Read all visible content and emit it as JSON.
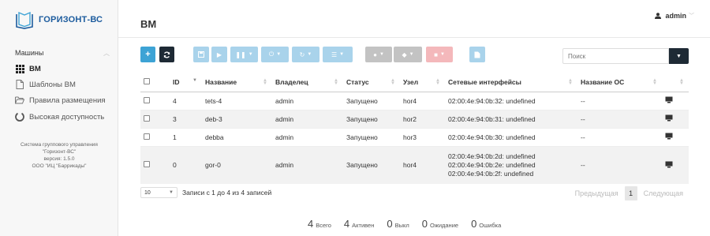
{
  "logo": {
    "text": "ГОРИЗОНТ-ВС"
  },
  "sidebar": {
    "section": "Машины",
    "items": [
      {
        "label": "ВМ",
        "icon": "grid-icon",
        "active": true
      },
      {
        "label": "Шаблоны ВМ",
        "icon": "file-icon",
        "active": false
      },
      {
        "label": "Правила размещения",
        "icon": "folder-open-icon",
        "active": false
      },
      {
        "label": "Высокая доступность",
        "icon": "circle-notch-icon",
        "active": false
      }
    ],
    "info": {
      "line1": "Система группового управления",
      "line2": "\"Горизонт-ВС\"",
      "line3": "версия: 1.5.0",
      "line4": "ООО \"ИЦ \"Баррикады\""
    }
  },
  "header": {
    "title": "ВМ",
    "user": "admin"
  },
  "search": {
    "placeholder": "Поиск"
  },
  "table": {
    "columns": [
      "ID",
      "Название",
      "Владелец",
      "Статус",
      "Узел",
      "Сетевые интерфейсы",
      "Название ОС"
    ],
    "rows": [
      {
        "id": "4",
        "name": "tets-4",
        "owner": "admin",
        "status": "Запущено",
        "host": "hor4",
        "nets": [
          "02:00:4e:94:0b:32: undefined"
        ],
        "os": "--"
      },
      {
        "id": "3",
        "name": "deb-3",
        "owner": "admin",
        "status": "Запущено",
        "host": "hor2",
        "nets": [
          "02:00:4e:94:0b:31: undefined"
        ],
        "os": "--"
      },
      {
        "id": "1",
        "name": "debba",
        "owner": "admin",
        "status": "Запущено",
        "host": "hor3",
        "nets": [
          "02:00:4e:94:0b:30: undefined"
        ],
        "os": "--"
      },
      {
        "id": "0",
        "name": "gor-0",
        "owner": "admin",
        "status": "Запущено",
        "host": "hor4",
        "nets": [
          "02:00:4e:94:0b:2d: undefined",
          "02:00:4e:94:0b:2e: undefined",
          "02:00:4e:94:0b:2f: undefined"
        ],
        "os": "--"
      }
    ]
  },
  "footer": {
    "page_size": "10",
    "records": "Записи с 1 до 4 из 4 записей",
    "prev": "Предыдущая",
    "page": "1",
    "next": "Следующая"
  },
  "stats": [
    {
      "n": "4",
      "label": "Всего"
    },
    {
      "n": "4",
      "label": "Активен"
    },
    {
      "n": "0",
      "label": "Выкл"
    },
    {
      "n": "0",
      "label": "Ожидание"
    },
    {
      "n": "0",
      "label": "Ошибка"
    }
  ],
  "colors": {
    "brand": "#1d5c9e",
    "primary": "#3da3d5",
    "dark": "#1e2a35"
  }
}
